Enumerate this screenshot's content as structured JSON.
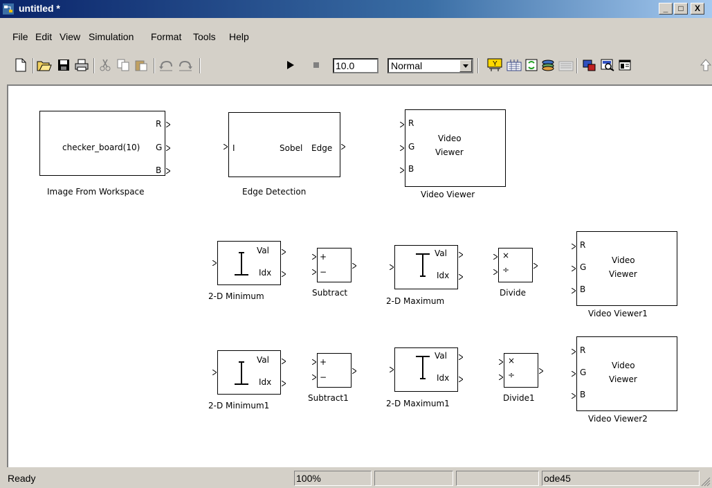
{
  "window": {
    "title": "untitled *",
    "controls": {
      "minimize": "_",
      "maximize": "□",
      "close": "X"
    }
  },
  "menu": [
    "File",
    "Edit",
    "View",
    "Simulation",
    "Format",
    "Tools",
    "Help"
  ],
  "toolbar": {
    "stop_time": "10.0",
    "sim_mode": "Normal",
    "icons": [
      "new-model-icon",
      "open-icon",
      "save-icon",
      "print-icon",
      "cut-icon",
      "copy-icon",
      "paste-icon",
      "undo-icon",
      "redo-icon",
      "start-simulation-icon",
      "stop-simulation-icon",
      "build-icon",
      "update-diagram-icon",
      "refresh-icon",
      "library-browser-icon",
      "model-explorer-icon",
      "debugger-icon",
      "properties-icon",
      "up-icon"
    ]
  },
  "blocks": {
    "image_from_workspace": {
      "content": "checker_board(10)",
      "ports_out": [
        "R",
        "G",
        "B"
      ],
      "caption": "Image From Workspace"
    },
    "edge_detection": {
      "port_in": "I",
      "method": "Sobel",
      "port_out": "Edge",
      "caption": "Edge Detection"
    },
    "video_viewer": {
      "ports_in": [
        "R",
        "G",
        "B"
      ],
      "line1": "Video",
      "line2": "Viewer",
      "caption": "Video Viewer"
    },
    "minimum": {
      "port_val": "Val",
      "port_idx": "Idx",
      "caption": "2-D Minimum"
    },
    "subtract": {
      "plus": "+",
      "minus": "−",
      "caption": "Subtract"
    },
    "maximum": {
      "port_val": "Val",
      "port_idx": "Idx",
      "caption": "2-D Maximum"
    },
    "divide": {
      "times": "×",
      "div": "÷",
      "caption": "Divide"
    },
    "video_viewer1": {
      "ports_in": [
        "R",
        "G",
        "B"
      ],
      "line1": "Video",
      "line2": "Viewer",
      "caption": "Video Viewer1"
    },
    "minimum1": {
      "port_val": "Val",
      "port_idx": "Idx",
      "caption": "2-D Minimum1"
    },
    "subtract1": {
      "plus": "+",
      "minus": "−",
      "caption": "Subtract1"
    },
    "maximum1": {
      "port_val": "Val",
      "port_idx": "Idx",
      "caption": "2-D Maximum1"
    },
    "divide1": {
      "times": "×",
      "div": "÷",
      "caption": "Divide1"
    },
    "video_viewer2": {
      "ports_in": [
        "R",
        "G",
        "B"
      ],
      "line1": "Video",
      "line2": "Viewer",
      "caption": "Video Viewer2"
    }
  },
  "status": {
    "state": "Ready",
    "zoom": "100%",
    "solver": "ode45"
  }
}
